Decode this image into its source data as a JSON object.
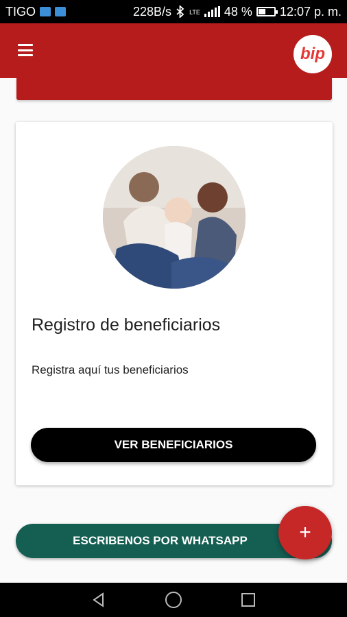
{
  "status_bar": {
    "carrier": "TIGO",
    "speed": "228B/s",
    "network": "LTE",
    "battery": "48 %",
    "battery_level": 0.48,
    "time": "12:07 p. m.",
    "icons": [
      "notification-icon",
      "image-icon",
      "bluetooth-icon",
      "signal-icon",
      "battery-icon"
    ]
  },
  "app_bar": {
    "menu_icon": "hamburger-menu-icon",
    "logo_text": "bip",
    "color": "#b71c1c"
  },
  "card": {
    "title": "Registro de beneficiarios",
    "subtitle": "Registra aquí tus beneficiarios",
    "button_label": "VER BENEFICIARIOS",
    "image": "family-photo"
  },
  "whatsapp_button": {
    "label": "ESCRIBENOS POR WHATSAPP",
    "color": "#145e52"
  },
  "fab": {
    "label": "+",
    "color": "#c62828"
  },
  "nav_bar": {
    "icons": [
      "back-icon",
      "home-icon",
      "recents-icon"
    ]
  }
}
